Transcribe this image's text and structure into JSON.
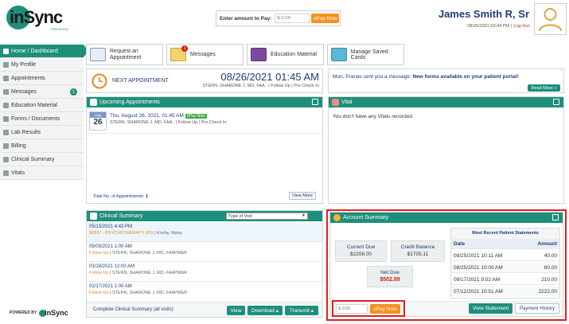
{
  "header": {
    "logo_text": "inSync",
    "logo_sub": "PREVISION",
    "pay_label": "Enter amount to Pay:",
    "pay_placeholder": "$ 0.00",
    "pay_button": "ePay Now",
    "user_name": "James Smith R, Sr",
    "timestamp": "08/25/2021 03:44 PM",
    "separator": "|",
    "logout": "Log Out"
  },
  "sidebar": {
    "items": [
      {
        "label": "Home / Dashboard",
        "icon": "home-icon"
      },
      {
        "label": "My Profile",
        "icon": "user-icon"
      },
      {
        "label": "Appointments",
        "icon": "calendar-icon"
      },
      {
        "label": "Messages",
        "icon": "envelope-icon",
        "badge": "1"
      },
      {
        "label": "Education Material",
        "icon": "book-icon"
      },
      {
        "label": "Forms / Documents",
        "icon": "document-icon"
      },
      {
        "label": "Lab Results",
        "icon": "flask-icon"
      },
      {
        "label": "Billing",
        "icon": "dollar-icon"
      },
      {
        "label": "Clinical Summary",
        "icon": "clipboard-icon"
      },
      {
        "label": "Vitals",
        "icon": "heart-icon"
      }
    ],
    "powered_by": "POWERED BY",
    "powered_logo": "inSync"
  },
  "quick_actions": {
    "request": {
      "line1": "Request an",
      "line2": "Appointment"
    },
    "messages": {
      "label": "Messages",
      "badge": "1"
    },
    "education": {
      "label": "Education Material"
    },
    "cards": {
      "label": "Manage Saved Cards"
    }
  },
  "next_appt": {
    "label": "NEXT APPOINTMENT",
    "datetime": "08/26/2021 01:45 AM",
    "details": "STERN, SHARONE J, MD, FAA.. | Follow Up | Pre Check In"
  },
  "message_banner": {
    "sender": "Mori, Pranav sent you a message:",
    "subject": "New forms available on your patient portal!",
    "read_more": "Read More »"
  },
  "upcoming": {
    "title": "Upcoming Appointments",
    "cal_month": "Aug",
    "cal_day": "26",
    "date_line": "Thu, August 26, 2021, 01:45 AM",
    "epay_badge": "ePay Now",
    "details": "STERN, SHARONE J, MD, FAA.. | Follow Up | Pre Check In",
    "total_label": "Total No. of Appointments:",
    "total_value": "1",
    "view_more": "View More"
  },
  "vital": {
    "title": "Vital",
    "empty": "You don't have any Vitals recorded."
  },
  "clinical": {
    "title": "Clinical Summary",
    "select_value": "Type of Visit",
    "entries": [
      {
        "date": "05/13/2021 4:43 PM",
        "line2_accent": "90837 - PSYCHOTHERAPY (60)",
        "line2_rest": " | Koshy, Ripsy"
      },
      {
        "date": "05/03/2021 1:00 AM",
        "line2_accent": "Follow Up",
        "line2_rest": " | STERN, SHARONE J, MD, FAAPM&R"
      },
      {
        "date": "03/19/2021 12:00 AM",
        "line2_accent": "Follow Up",
        "line2_rest": " | STERN, SHARONE J, MD, FAAPM&R"
      },
      {
        "date": "02/17/2021 1:00 AM",
        "line2_accent": "Follow Up",
        "line2_rest": " | STERN, SHARONE J, MD, FAAPM&R"
      }
    ],
    "footer_link": "Complete Clinical Summary (all visits)",
    "view": "View",
    "download": "Download ▴",
    "transmit": "Transmit ▴"
  },
  "account": {
    "title": "Account Summary",
    "current_due_label": "Current Due",
    "current_due_value": "$2208.00",
    "credit_label": "Credit Balance",
    "credit_value": "$1705.11",
    "net_due_label": "Net Due",
    "net_due_value": "$502.89",
    "statements_title": "Most Recent Patient Statements",
    "col_date": "Date",
    "col_amount": "Amount",
    "statements": [
      {
        "date": "08/25/2021 10:11 AM",
        "amount": "40.00"
      },
      {
        "date": "08/25/2021 10:00 AM",
        "amount": "60.00"
      },
      {
        "date": "08/17/2021 9:52 AM",
        "amount": "210.00"
      },
      {
        "date": "07/12/2021 10:51 AM",
        "amount": "2222.00"
      }
    ],
    "pay_placeholder": "$ 0.00",
    "pay_button": "ePay Now",
    "view_statement": "View Statement",
    "payment_history": "Payment History"
  },
  "colors": {
    "teal": "#1d8f7a",
    "orange": "#f5901e",
    "highlight_red": "#e02020"
  }
}
